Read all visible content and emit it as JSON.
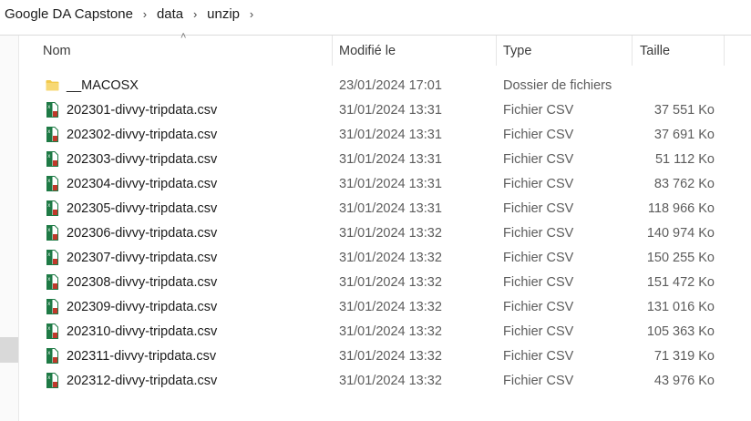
{
  "breadcrumb": [
    "Google DA Capstone",
    "data",
    "unzip"
  ],
  "columns": {
    "name": "Nom",
    "modified": "Modifié le",
    "type": "Type",
    "size": "Taille"
  },
  "sort": {
    "column": "name",
    "direction": "ascending"
  },
  "files": [
    {
      "name": "__MACOSX",
      "modified": "23/01/2024 17:01",
      "type": "Dossier de fichiers",
      "size": "",
      "icon": "folder-icon"
    },
    {
      "name": "202301-divvy-tripdata.csv",
      "modified": "31/01/2024 13:31",
      "type": "Fichier CSV",
      "size": "37 551 Ko",
      "icon": "csv-file-icon"
    },
    {
      "name": "202302-divvy-tripdata.csv",
      "modified": "31/01/2024 13:31",
      "type": "Fichier CSV",
      "size": "37 691 Ko",
      "icon": "csv-file-icon"
    },
    {
      "name": "202303-divvy-tripdata.csv",
      "modified": "31/01/2024 13:31",
      "type": "Fichier CSV",
      "size": "51 112 Ko",
      "icon": "csv-file-icon"
    },
    {
      "name": "202304-divvy-tripdata.csv",
      "modified": "31/01/2024 13:31",
      "type": "Fichier CSV",
      "size": "83 762 Ko",
      "icon": "csv-file-icon"
    },
    {
      "name": "202305-divvy-tripdata.csv",
      "modified": "31/01/2024 13:31",
      "type": "Fichier CSV",
      "size": "118 966 Ko",
      "icon": "csv-file-icon"
    },
    {
      "name": "202306-divvy-tripdata.csv",
      "modified": "31/01/2024 13:32",
      "type": "Fichier CSV",
      "size": "140 974 Ko",
      "icon": "csv-file-icon"
    },
    {
      "name": "202307-divvy-tripdata.csv",
      "modified": "31/01/2024 13:32",
      "type": "Fichier CSV",
      "size": "150 255 Ko",
      "icon": "csv-file-icon"
    },
    {
      "name": "202308-divvy-tripdata.csv",
      "modified": "31/01/2024 13:32",
      "type": "Fichier CSV",
      "size": "151 472 Ko",
      "icon": "csv-file-icon"
    },
    {
      "name": "202309-divvy-tripdata.csv",
      "modified": "31/01/2024 13:32",
      "type": "Fichier CSV",
      "size": "131 016 Ko",
      "icon": "csv-file-icon"
    },
    {
      "name": "202310-divvy-tripdata.csv",
      "modified": "31/01/2024 13:32",
      "type": "Fichier CSV",
      "size": "105 363 Ko",
      "icon": "csv-file-icon"
    },
    {
      "name": "202311-divvy-tripdata.csv",
      "modified": "31/01/2024 13:32",
      "type": "Fichier CSV",
      "size": "71 319 Ko",
      "icon": "csv-file-icon"
    },
    {
      "name": "202312-divvy-tripdata.csv",
      "modified": "31/01/2024 13:32",
      "type": "Fichier CSV",
      "size": "43 976 Ko",
      "icon": "csv-file-icon"
    }
  ],
  "colors": {
    "folder": "#f2c94c",
    "csv_green": "#1e7a45",
    "csv_red": "#c0392b"
  }
}
